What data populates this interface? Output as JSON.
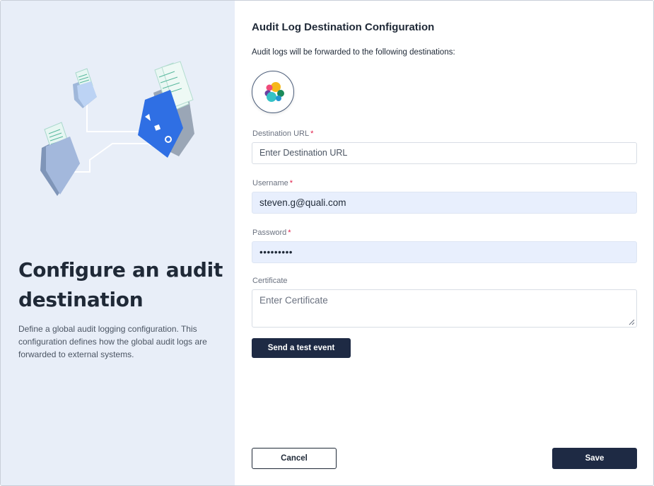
{
  "left_panel": {
    "title": "Configure an audit destination",
    "description": "Define a global audit logging configuration. This configuration defines how the global audit logs are forwarded to external systems."
  },
  "form": {
    "heading": "Audit Log Destination Configuration",
    "subtext": "Audit logs will be forwarded to the following destinations:",
    "destination_icon": "elastic-logo-icon",
    "fields": {
      "destination_url": {
        "label": "Destination URL",
        "required_mark": "*",
        "value": "",
        "placeholder": "Enter Destination URL"
      },
      "username": {
        "label": "Username",
        "required_mark": "*",
        "value": "steven.g@quali.com"
      },
      "password": {
        "label": "Password",
        "required_mark": "*",
        "value": "•••••••••"
      },
      "certificate": {
        "label": "Certificate",
        "value": "",
        "placeholder": "Enter Certificate"
      }
    },
    "test_button": "Send a test event"
  },
  "footer": {
    "cancel_label": "Cancel",
    "save_label": "Save"
  },
  "colors": {
    "left_panel_bg": "#e8eef8",
    "primary_button": "#1e2a44",
    "filled_input_bg": "#e8effd",
    "required": "#e11d48"
  }
}
